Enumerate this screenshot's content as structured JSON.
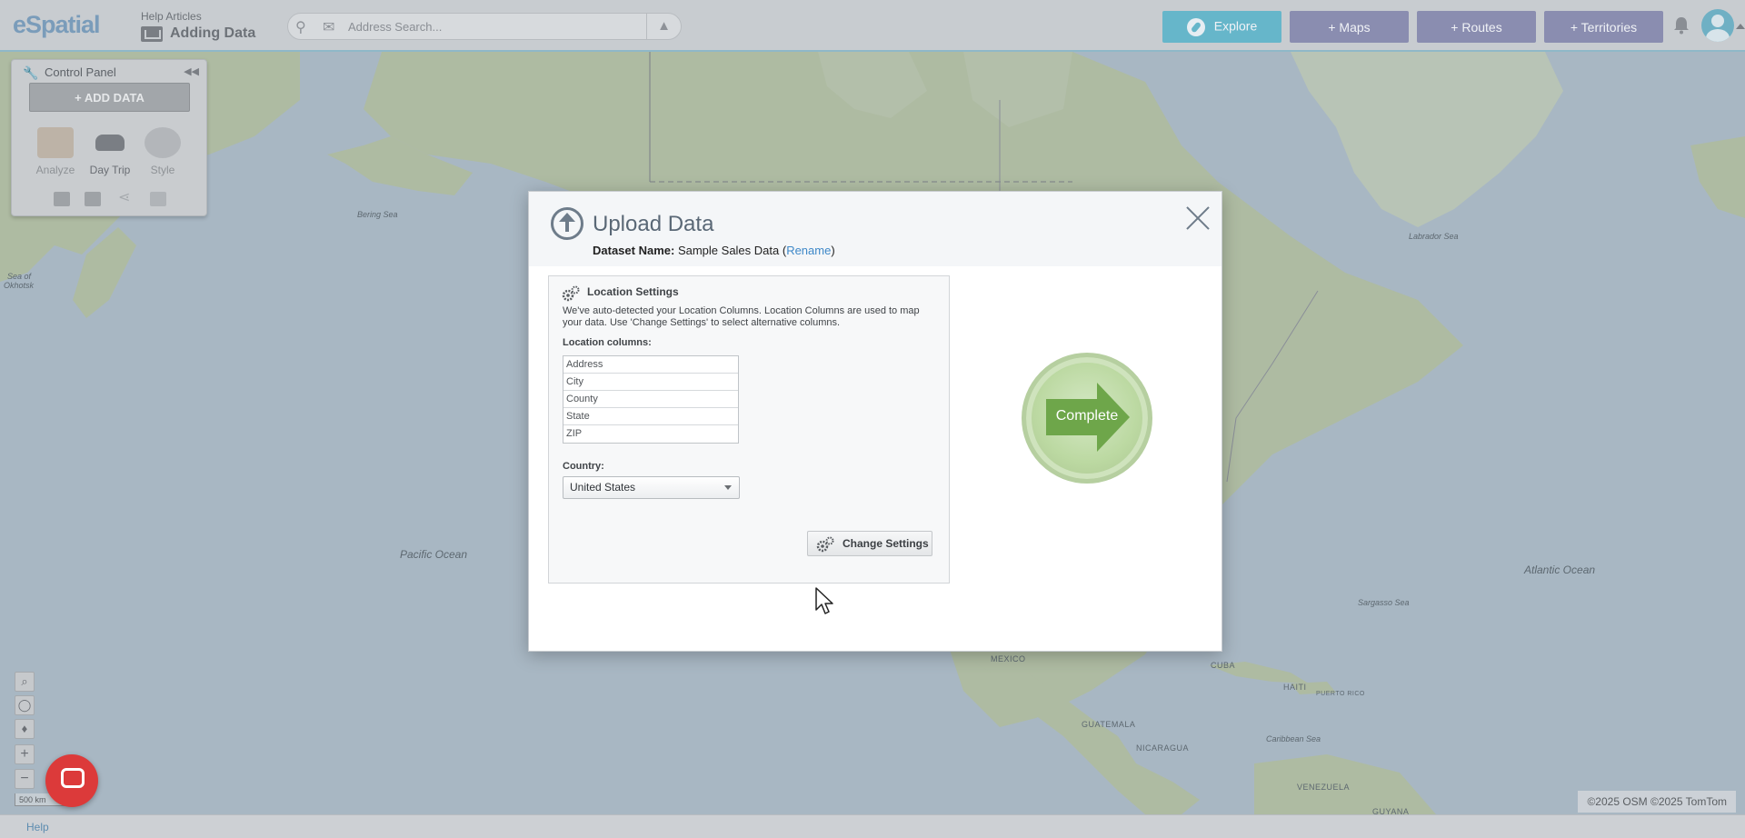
{
  "app": {
    "logo": "eSpatial",
    "help_articles_label": "Help Articles",
    "page_title": "Adding Data"
  },
  "search": {
    "placeholder": "Address Search..."
  },
  "topnav": {
    "explore_label": "Explore",
    "maps_label": "+ Maps",
    "routes_label": "+ Routes",
    "territories_label": "+ Territories"
  },
  "control_panel": {
    "title": "Control Panel",
    "add_data_label": "ADD DATA",
    "tools": [
      {
        "label": "Analyze",
        "icon": "analyze-icon"
      },
      {
        "label": "Day Trip",
        "icon": "car-icon"
      },
      {
        "label": "Style",
        "icon": "style-icon"
      }
    ]
  },
  "map": {
    "labels": {
      "bering_sea": "Bering Sea",
      "sea_okhotsk_1": "Sea of",
      "sea_okhotsk_2": "Okhotsk",
      "pacific_ocean": "Pacific Ocean",
      "atlantic_ocean": "Atlantic Ocean",
      "labrador_sea": "Labrador Sea",
      "sargasso_sea": "Sargasso Sea",
      "mexico": "MEXICO",
      "cuba": "CUBA",
      "haiti": "HAITI",
      "guatemala": "GUATEMALA",
      "nicaragua": "NICARAGUA",
      "caribbean_sea": "Caribbean Sea",
      "venezuela": "VENEZUELA",
      "guyana": "GUYANA",
      "pr": "PUERTO RICO"
    },
    "scale": "500 km",
    "attribution": "©2025 OSM ©2025 TomTom"
  },
  "footer": {
    "help_label": "Help"
  },
  "modal": {
    "title": "Upload Data",
    "dataset_label": "Dataset Name:",
    "dataset_name": "Sample Sales Data",
    "rename_label": "Rename",
    "location_settings": {
      "title": "Location Settings",
      "description": "We've auto-detected your Location Columns. Location Columns are used to map your data. Use 'Change Settings' to select alternative columns.",
      "columns_label": "Location columns:",
      "columns": [
        "Address",
        "City",
        "County",
        "State",
        "ZIP"
      ],
      "country_label": "Country:",
      "country_value": "United States",
      "change_settings_label": "Change Settings"
    },
    "complete_label": "Complete"
  }
}
